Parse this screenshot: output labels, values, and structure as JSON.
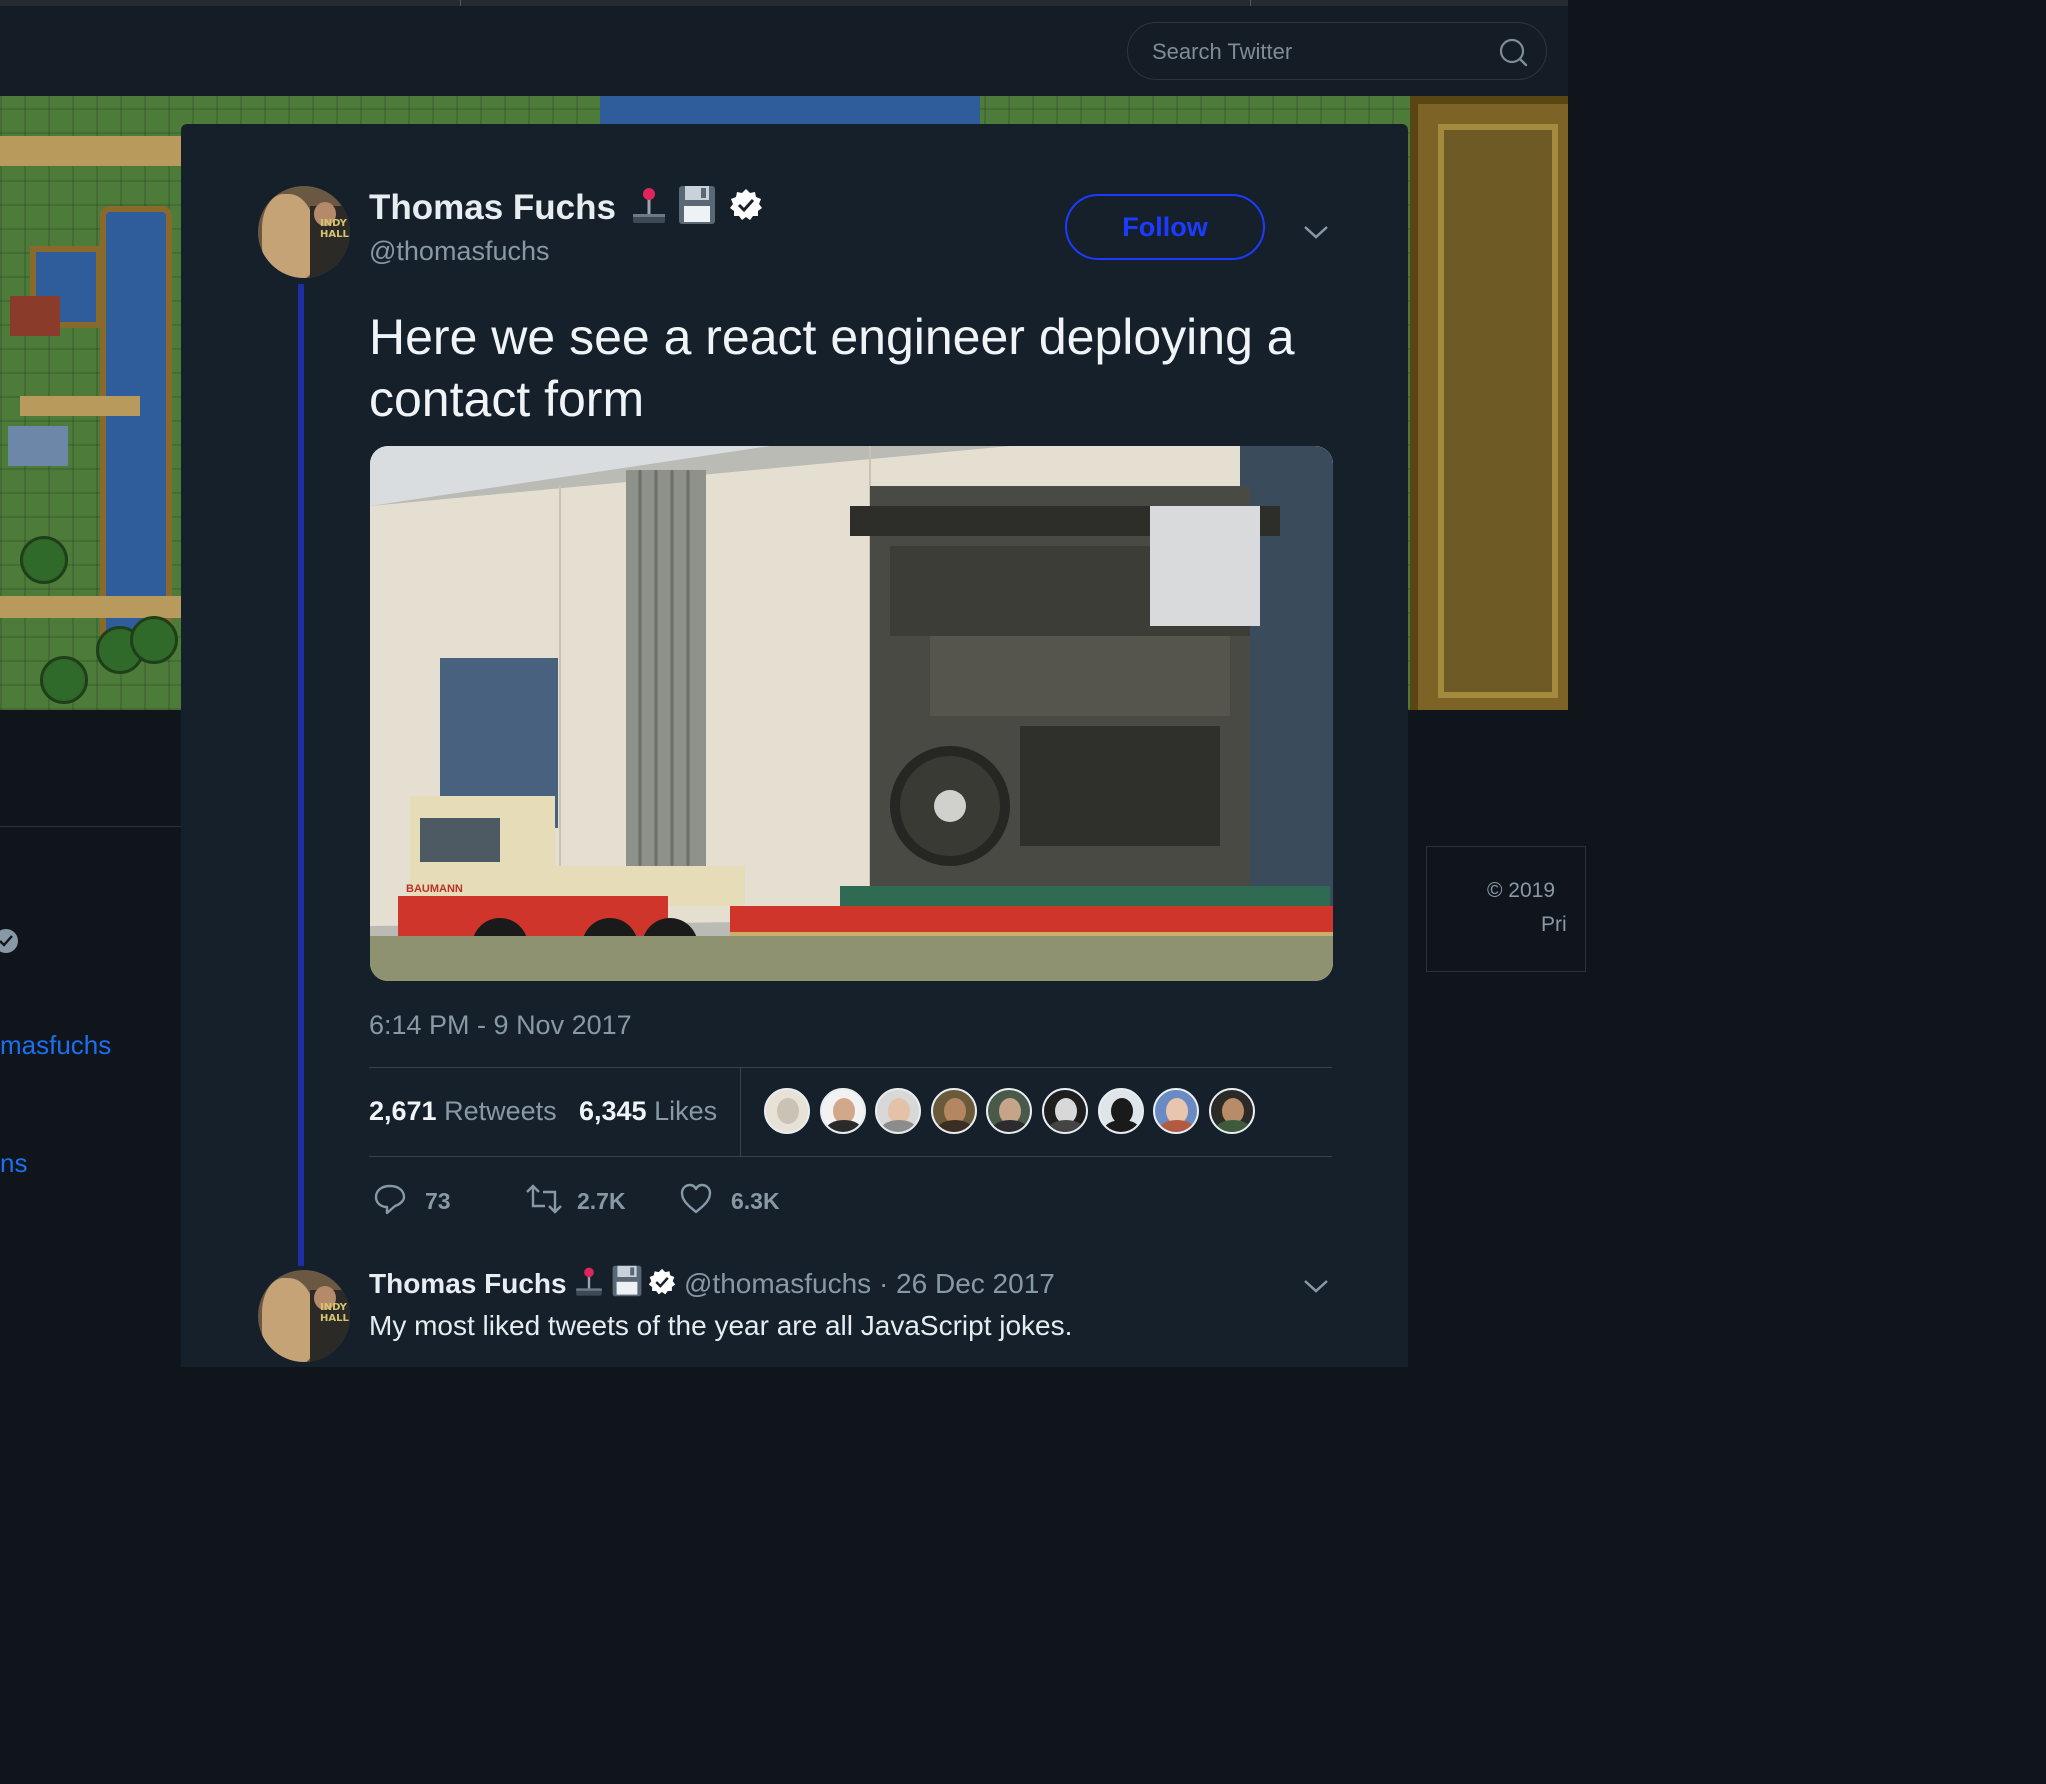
{
  "header": {
    "search_placeholder": "Search Twitter"
  },
  "side": {
    "left_handle_fragment": "masfuchs",
    "left_fragment_2": "ns",
    "copyright": "© 2019",
    "privacy_fragment": "Pri"
  },
  "tweet": {
    "author_name": "Thomas Fuchs",
    "author_handle": "@thomasfuchs",
    "follow_label": "Follow",
    "text": "Here we see a react engineer deploying a contact form",
    "timestamp": "6:14 PM - 9 Nov 2017",
    "retweets_count": "2,671",
    "retweets_label": "Retweets",
    "likes_count": "6,345",
    "likes_label": "Likes",
    "replies_short": "73",
    "retweets_short": "2.7K",
    "likes_short": "6.3K",
    "image_truck_text": "BAUMANN",
    "avatar_tee_text_1": "INDY",
    "avatar_tee_text_2": "HALL"
  },
  "reply": {
    "author_name": "Thomas Fuchs",
    "meta": "@thomasfuchs · 26 Dec 2017",
    "text": "My most liked tweets of the year are all JavaScript jokes."
  },
  "colors": {
    "background": "#10151c",
    "card": "#15202b",
    "accent_blue": "#1c3bff",
    "thread_line": "#1d2fa3",
    "muted": "#8899a6"
  },
  "icons": [
    "search-icon",
    "joystick-icon",
    "floppy-disk-icon",
    "verified-icon",
    "chevron-down-icon",
    "reply-icon",
    "retweet-icon",
    "like-icon"
  ]
}
